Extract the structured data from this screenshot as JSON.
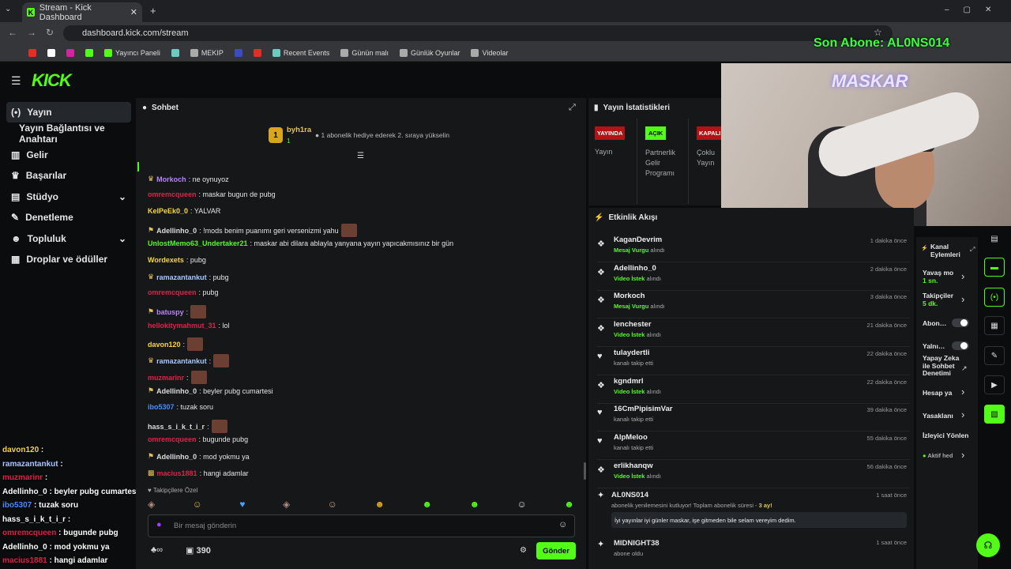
{
  "browser": {
    "tab_title": "Stream - Kick Dashboard",
    "url": "dashboard.kick.com/stream",
    "bookmarks": [
      "Yayıncı Paneli",
      "MEKIP",
      "Recent Events",
      "Günün malı",
      "Günlük Oyunlar",
      "Videolar"
    ]
  },
  "overlay": {
    "last_sub": "Son Abone: AL0NS014",
    "cam_name": "MASKAR"
  },
  "sidebar": {
    "items": [
      "Yayın",
      "Yayın Bağlantısı ve Anahtarı",
      "Gelir",
      "Başarılar",
      "Stüdyo",
      "Denetleme",
      "Topluluk",
      "Droplar ve ödüller"
    ]
  },
  "chat": {
    "title": "Sohbet",
    "top_user": "byh1ra",
    "top_rank": "1",
    "top_count": "1",
    "promo": "1 abonelik hediye ederek 2. sıraya yükselin",
    "messages": [
      {
        "user": "Morkoch",
        "text": ": ne oynuyoz",
        "color": "#b884ff"
      },
      {
        "user": "omremcqueen",
        "text": ": maskar bugun de pubg",
        "color": "#e0204a"
      },
      {
        "user": "KelPeEk0_0",
        "text": ": YALVAR",
        "color": "#f5d640"
      },
      {
        "user": "Adellinho_0",
        "text": ": !mods benim puanımı geri versenizmi yahu",
        "color": "#dddddd"
      },
      {
        "user": "UnlostMemo63_Undertaker21",
        "text": ": maskar abi dilara ablayla yanyana yayın yapıcakmısınız bir gün",
        "color": "#53fc18"
      },
      {
        "user": "Wordexets",
        "text": ": pubg",
        "color": "#f5d640"
      },
      {
        "user": "ramazantankut",
        "text": ": pubg",
        "color": "#a9c7ff"
      },
      {
        "user": "omremcqueen",
        "text": ": pubg",
        "color": "#e0204a"
      },
      {
        "user": "batuspy",
        "text": ":",
        "color": "#b884ff"
      },
      {
        "user": "hellokitymahmut_31",
        "text": ": lol",
        "color": "#e0204a"
      },
      {
        "user": "davon120",
        "text": ":",
        "color": "#f5d640"
      },
      {
        "user": "ramazantankut",
        "text": ":",
        "color": "#a9c7ff"
      },
      {
        "user": "muzmarinr",
        "text": ":",
        "color": "#e0204a"
      },
      {
        "user": "Adellinho_0",
        "text": ": beyler pubg cumartesi",
        "color": "#dddddd"
      },
      {
        "user": "ibo5307",
        "text": ": tuzak soru",
        "color": "#4a8cff"
      },
      {
        "user": "hass_s_i_k_t_i_r",
        "text": ":",
        "color": "#dddddd"
      },
      {
        "user": "omremcqueen",
        "text": ": bugunde pubg",
        "color": "#e0204a"
      },
      {
        "user": "Adellinho_0",
        "text": ": mod yokmu ya",
        "color": "#dddddd"
      },
      {
        "user": "macius1881",
        "text": ": hangi adamlar",
        "color": "#e0204a"
      }
    ],
    "followers_only": "Takipçilere Özel",
    "input_placeholder": "Bir mesaj gönderin",
    "points": "390",
    "send": "Gönder"
  },
  "stats": {
    "title": "Yayın İstatistikleri",
    "badges": [
      {
        "badge": "YAYINDA",
        "label": "Yayın"
      },
      {
        "badge": "AÇIK",
        "label": "Partnerlik Gelir Programı"
      },
      {
        "badge": "KAPALI",
        "label": "Çoklu Yayın"
      }
    ]
  },
  "events": {
    "title": "Etkinlik Akışı",
    "items": [
      {
        "name": "KaganDevrim",
        "hl": "Mesaj Vurgu",
        "rest": " alındı",
        "time": "1 dakika önce",
        "icon": "gift"
      },
      {
        "name": "Adellinho_0",
        "hl": "Video İstek",
        "rest": " alındı",
        "time": "2 dakika önce",
        "icon": "gift"
      },
      {
        "name": "Morkoch",
        "hl": "Mesaj Vurgu",
        "rest": " alındı",
        "time": "3 dakika önce",
        "icon": "gift"
      },
      {
        "name": "lenchester",
        "hl": "Video İstek",
        "rest": " alındı",
        "time": "21 dakika önce",
        "icon": "gift"
      },
      {
        "name": "tulaydertli",
        "hl": "",
        "rest": "kanalı takip etti",
        "time": "22 dakika önce",
        "icon": "heart"
      },
      {
        "name": "kgndmrl",
        "hl": "Video İstek",
        "rest": " alındı",
        "time": "22 dakika önce",
        "icon": "gift"
      },
      {
        "name": "16CmPipisimVar",
        "hl": "",
        "rest": "kanalı takip etti",
        "time": "39 dakika önce",
        "icon": "heart"
      },
      {
        "name": "AlpMeloo",
        "hl": "",
        "rest": "kanalı takip etti",
        "time": "55 dakika önce",
        "icon": "heart"
      },
      {
        "name": "erlikhanqw",
        "hl": "Video İstek",
        "rest": " alındı",
        "time": "56 dakika önce",
        "icon": "gift"
      }
    ],
    "resub": {
      "name": "AL0NS014",
      "pre": "abonelik yenilemesini kutluyor! Toplam abonelik süresi - ",
      "months": "3 ay!",
      "msg": "İyi yayınlar iyi günler maskar, işe gitmeden bile selam vereyim dedim.",
      "time": "1 saat önce"
    },
    "last": {
      "name": "MIDNIGHT38",
      "sub": "abone oldu",
      "time": "1 saat önce"
    }
  },
  "actions": {
    "title": "Kanal Eylemleri",
    "slow": "Yavaş mo",
    "slow_v": "1 sn.",
    "follow": "Takipçiler",
    "follow_v": "5 dk.",
    "abon": "Abon…",
    "yalni": "Yalnı…",
    "ai": "Yapay Zeka ile Sohbet Denetimi",
    "hesap": "Hesap ya",
    "ban": "Yasaklanı",
    "viewer": "İzleyici Yönlen",
    "active": "Aktif hed"
  },
  "overlay_chat": [
    {
      "user": "davon120",
      "text": " :",
      "color": "#f5d640"
    },
    {
      "user": "ramazantankut",
      "text": " :",
      "color": "#a9c7ff"
    },
    {
      "user": "muzmarinr",
      "text": " :",
      "color": "#e0204a"
    },
    {
      "user": "Adellinho_0",
      "text": " : beyler pubg cumartesi",
      "color": "#ffffff"
    },
    {
      "user": "ibo5307",
      "text": " : tuzak soru",
      "color": "#4a8cff"
    },
    {
      "user": "hass_s_i_k_t_i_r",
      "text": " :",
      "color": "#ffffff"
    },
    {
      "user": "omremcqueen",
      "text": " : bugunde pubg",
      "color": "#e0204a"
    },
    {
      "user": "Adellinho_0",
      "text": " : mod yokmu ya",
      "color": "#ffffff"
    },
    {
      "user": "macius1881",
      "text": " : hangi adamlar",
      "color": "#e0204a"
    }
  ]
}
